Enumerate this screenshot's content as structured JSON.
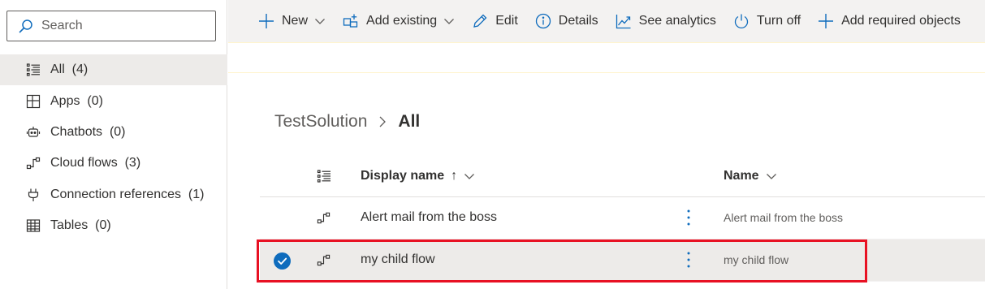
{
  "search": {
    "placeholder": "Search"
  },
  "sidebar": {
    "items": [
      {
        "label": "All",
        "count": "(4)",
        "icon": "list-icon",
        "active": true
      },
      {
        "label": "Apps",
        "count": "(0)",
        "icon": "apps-icon",
        "active": false
      },
      {
        "label": "Chatbots",
        "count": "(0)",
        "icon": "chatbot-icon",
        "active": false
      },
      {
        "label": "Cloud flows",
        "count": "(3)",
        "icon": "flow-icon",
        "active": false
      },
      {
        "label": "Connection references",
        "count": "(1)",
        "icon": "plug-icon",
        "active": false
      },
      {
        "label": "Tables",
        "count": "(0)",
        "icon": "table-icon",
        "active": false
      }
    ]
  },
  "toolbar": {
    "new_label": "New",
    "add_existing_label": "Add existing",
    "edit_label": "Edit",
    "details_label": "Details",
    "analytics_label": "See analytics",
    "turn_off_label": "Turn off",
    "add_required_label": "Add required objects"
  },
  "breadcrumb": {
    "parent": "TestSolution",
    "current": "All"
  },
  "grid": {
    "columns": {
      "display_name": "Display name",
      "sort_arrow": "↑",
      "name": "Name"
    },
    "rows": [
      {
        "display_name": "Alert mail from the boss",
        "name": "Alert mail from the boss",
        "selected": false
      },
      {
        "display_name": "my child flow",
        "name": "my child flow",
        "selected": true
      }
    ]
  },
  "colors": {
    "accent": "#0f6cbd",
    "highlight": "#e81123",
    "selected_bg": "#edebe9",
    "commandbar_bg": "#f3f2f1"
  }
}
